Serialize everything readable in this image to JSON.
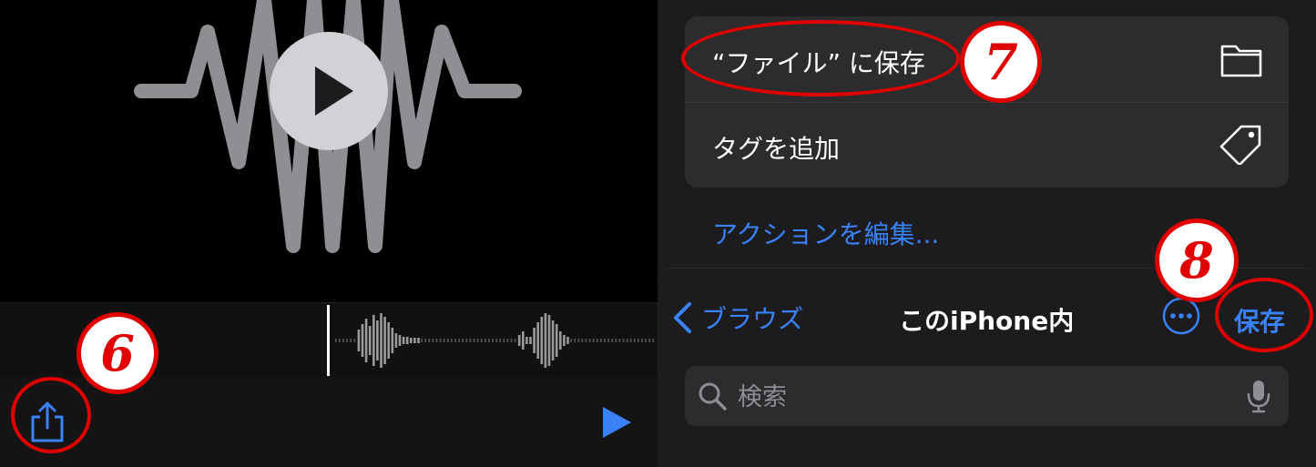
{
  "left": {
    "icons": {
      "art": "waveform-icon",
      "play_large": "play-icon",
      "share": "share-icon",
      "play_small": "play-icon"
    }
  },
  "markers": {
    "step6": "6",
    "step7": "7",
    "step8": "8"
  },
  "right": {
    "menu": {
      "items": [
        {
          "label": "“ファイル” に保存",
          "icon": "folder-icon"
        },
        {
          "label": "タグを追加",
          "icon": "tag-icon"
        }
      ],
      "edit_actions": "アクションを編集..."
    },
    "sheet": {
      "back_label": "ブラウズ",
      "title": "このiPhone内",
      "save_label": "保存",
      "search_placeholder": "検索"
    }
  },
  "colors": {
    "accent": "#3a82f7",
    "marker": "#e00000",
    "card": "#2c2c2e",
    "sheet": "#1c1c1e"
  }
}
